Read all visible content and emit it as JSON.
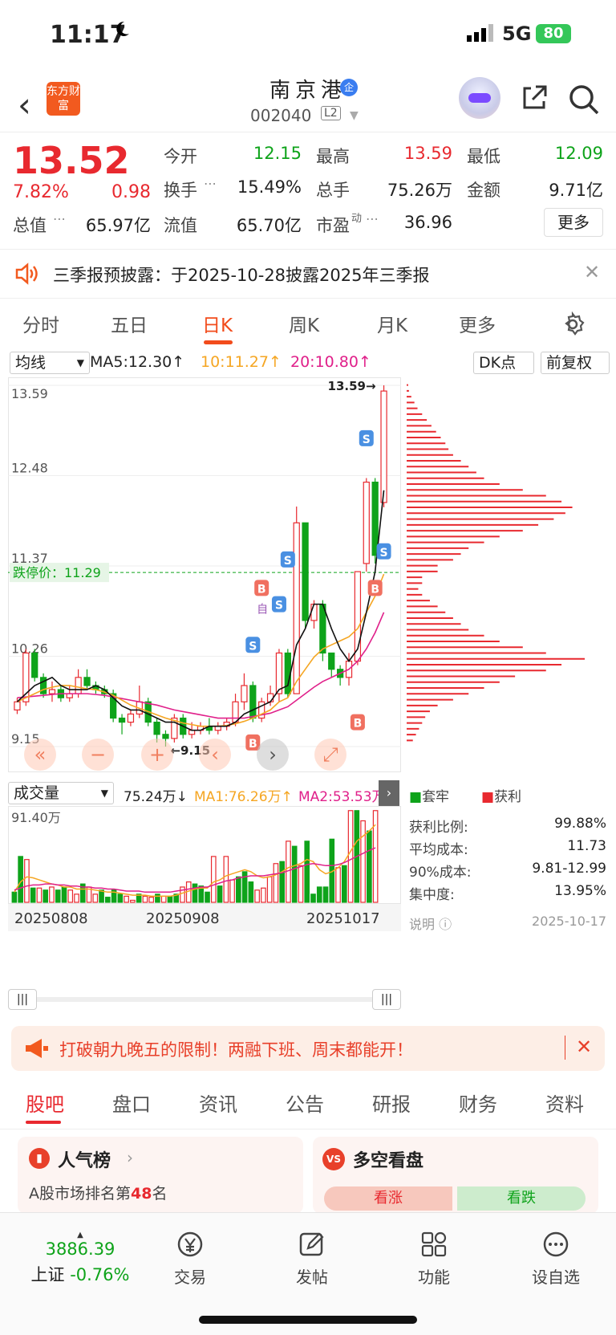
{
  "status": {
    "time": "11:17",
    "network": "5G",
    "battery": "80"
  },
  "header": {
    "logo": "东方财富",
    "name": "南京港",
    "badge": "企",
    "code": "002040",
    "level": "L2"
  },
  "quote": {
    "price": "13.52",
    "pct": "7.82%",
    "change": "0.98",
    "fields": [
      {
        "label": "今开",
        "value": "12.15",
        "color": "green"
      },
      {
        "label": "最高",
        "value": "13.59",
        "color": "red"
      },
      {
        "label": "最低",
        "value": "12.09",
        "color": "green"
      },
      {
        "label": "换手",
        "value": "15.49%",
        "color": "black"
      },
      {
        "label": "总手",
        "value": "75.26万",
        "color": "black"
      },
      {
        "label": "金额",
        "value": "9.71亿",
        "color": "black"
      },
      {
        "label": "总值",
        "value": "65.97亿",
        "color": "black"
      },
      {
        "label": "流值",
        "value": "65.70亿",
        "color": "black"
      },
      {
        "label": "市盈",
        "sup": "动",
        "value": "36.96",
        "color": "black"
      }
    ],
    "more": "更多"
  },
  "notice": {
    "text": "三季报预披露：于2025-10-28披露2025年三季报"
  },
  "ktabs": [
    "分时",
    "五日",
    "日K",
    "周K",
    "月K",
    "更多"
  ],
  "ktab_active": 2,
  "ma": {
    "select": "均线",
    "ma5": "MA5:12.30",
    "ma10": "10:11.27",
    "ma20": "20:10.80",
    "dk": "DK点",
    "fq": "前复权"
  },
  "chart_labels": {
    "y_ticks": [
      "13.59",
      "12.48",
      "11.37",
      "10.26",
      "9.15"
    ],
    "limit_down": "跌停价：11.29",
    "high_mark": "13.59",
    "low_mark": "9.15",
    "auto": "自",
    "b": "B",
    "s": "S"
  },
  "chart_data": [
    {
      "type": "candlestick",
      "title": "日K",
      "ylim": [
        9.15,
        13.59
      ],
      "candles": [
        [
          9.6,
          9.7,
          9.55,
          9.75
        ],
        [
          9.7,
          10.3,
          9.65,
          10.35
        ],
        [
          10.3,
          10.0,
          9.95,
          10.35
        ],
        [
          10.0,
          9.8,
          9.75,
          10.05
        ],
        [
          9.8,
          9.85,
          9.7,
          9.95
        ],
        [
          9.85,
          9.75,
          9.7,
          9.9
        ],
        [
          9.75,
          9.8,
          9.7,
          9.9
        ],
        [
          9.8,
          10.0,
          9.75,
          10.1
        ],
        [
          10.0,
          9.9,
          9.85,
          10.1
        ],
        [
          9.9,
          9.85,
          9.8,
          9.95
        ],
        [
          9.85,
          9.8,
          9.75,
          9.9
        ],
        [
          9.8,
          9.5,
          9.45,
          9.85
        ],
        [
          9.5,
          9.45,
          9.3,
          9.55
        ],
        [
          9.45,
          9.55,
          9.4,
          9.6
        ],
        [
          9.55,
          9.7,
          9.5,
          9.9
        ],
        [
          9.7,
          9.45,
          9.4,
          9.75
        ],
        [
          9.45,
          9.3,
          9.2,
          9.5
        ],
        [
          9.3,
          9.25,
          9.15,
          9.35
        ],
        [
          9.25,
          9.5,
          9.2,
          9.55
        ],
        [
          9.5,
          9.3,
          9.25,
          9.55
        ],
        [
          9.3,
          9.35,
          9.25,
          9.45
        ],
        [
          9.35,
          9.4,
          9.3,
          9.45
        ],
        [
          9.4,
          9.35,
          9.3,
          9.5
        ],
        [
          9.35,
          9.4,
          9.3,
          9.45
        ],
        [
          9.4,
          9.45,
          9.35,
          9.5
        ],
        [
          9.45,
          9.7,
          9.4,
          9.8
        ],
        [
          9.7,
          9.9,
          9.6,
          10.05
        ],
        [
          9.9,
          9.5,
          9.45,
          9.95
        ],
        [
          9.5,
          9.7,
          9.45,
          9.75
        ],
        [
          9.7,
          9.8,
          9.65,
          9.9
        ],
        [
          9.8,
          10.3,
          9.7,
          10.35
        ],
        [
          10.3,
          9.8,
          9.75,
          10.35
        ],
        [
          9.8,
          11.9,
          9.8,
          12.1
        ],
        [
          11.9,
          10.7,
          10.6,
          11.9
        ],
        [
          10.7,
          10.9,
          10.6,
          10.95
        ],
        [
          10.9,
          10.3,
          10.2,
          10.95
        ],
        [
          10.3,
          10.1,
          10.0,
          10.3
        ],
        [
          10.1,
          10.0,
          9.9,
          10.15
        ],
        [
          10.0,
          10.2,
          9.9,
          10.3
        ],
        [
          10.2,
          11.3,
          10.15,
          11.3
        ],
        [
          11.4,
          12.4,
          11.3,
          12.45
        ],
        [
          12.4,
          11.5,
          11.4,
          12.45
        ],
        [
          12.15,
          13.52,
          12.09,
          13.59
        ]
      ],
      "ma5": [
        9.7,
        9.8,
        9.9,
        9.95,
        10.0,
        9.9,
        9.85,
        9.85,
        9.85,
        9.9,
        9.85,
        9.75,
        9.65,
        9.6,
        9.6,
        9.55,
        9.5,
        9.45,
        9.45,
        9.4,
        9.35,
        9.35,
        9.4,
        9.4,
        9.4,
        9.45,
        9.55,
        9.6,
        9.65,
        9.7,
        9.85,
        9.9,
        10.4,
        10.6,
        10.9,
        10.9,
        10.6,
        10.35,
        10.2,
        10.35,
        10.8,
        11.3,
        12.3
      ],
      "ma10": [
        9.7,
        9.75,
        9.8,
        9.85,
        9.88,
        9.9,
        9.9,
        9.88,
        9.86,
        9.85,
        9.82,
        9.78,
        9.72,
        9.66,
        9.62,
        9.58,
        9.54,
        9.5,
        9.47,
        9.44,
        9.42,
        9.4,
        9.4,
        9.4,
        9.41,
        9.43,
        9.46,
        9.5,
        9.55,
        9.6,
        9.7,
        9.75,
        9.95,
        10.1,
        10.25,
        10.35,
        10.4,
        10.45,
        10.5,
        10.6,
        10.8,
        11.0,
        11.27
      ],
      "ma20": [
        9.75,
        9.76,
        9.77,
        9.78,
        9.79,
        9.8,
        9.8,
        9.8,
        9.8,
        9.79,
        9.78,
        9.76,
        9.74,
        9.72,
        9.7,
        9.68,
        9.66,
        9.63,
        9.6,
        9.58,
        9.56,
        9.54,
        9.52,
        9.5,
        9.5,
        9.5,
        9.5,
        9.52,
        9.54,
        9.56,
        9.6,
        9.64,
        9.72,
        9.8,
        9.88,
        9.95,
        10.0,
        10.05,
        10.1,
        10.2,
        10.35,
        10.55,
        10.8
      ]
    },
    {
      "type": "bar",
      "title": "成交量",
      "ylim": [
        0,
        91.4
      ],
      "values": [
        10,
        45,
        42,
        14,
        14,
        12,
        15,
        12,
        15,
        12,
        8,
        18,
        15,
        8,
        12,
        5,
        12,
        8,
        6,
        2,
        8,
        6,
        5,
        8,
        6,
        6,
        8,
        15,
        20,
        18,
        16,
        10,
        45,
        16,
        45,
        22,
        25,
        30,
        20,
        12,
        14,
        25,
        38,
        40,
        60,
        55,
        36,
        60,
        8,
        15,
        15,
        62,
        34,
        36,
        90,
        90,
        80,
        70,
        90
      ],
      "ma1": [
        10,
        20,
        25,
        24,
        22,
        20,
        18,
        17,
        15,
        15,
        13,
        13,
        13,
        12,
        11,
        10,
        10,
        9,
        8,
        7,
        7,
        7,
        6,
        6,
        6,
        6,
        7,
        9,
        11,
        13,
        14,
        14,
        20,
        22,
        26,
        28,
        30,
        32,
        30,
        26,
        24,
        25,
        27,
        30,
        34,
        36,
        38,
        42,
        40,
        32,
        28,
        30,
        34,
        40,
        50,
        60,
        65,
        70,
        76.26
      ],
      "ma2": [
        12,
        14,
        16,
        17,
        17,
        18,
        18,
        17,
        17,
        16,
        16,
        15,
        15,
        14,
        14,
        13,
        13,
        12,
        11,
        11,
        11,
        10,
        10,
        10,
        10,
        10,
        11,
        12,
        13,
        14,
        15,
        15,
        17,
        19,
        21,
        22,
        24,
        25,
        26,
        26,
        26,
        27,
        28,
        29,
        31,
        33,
        35,
        37,
        38,
        37,
        36,
        36,
        37,
        39,
        42,
        45,
        48,
        51,
        53.53
      ]
    }
  ],
  "volume": {
    "select": "成交量",
    "vol": "75.24万",
    "ma1": "MA1:76.26万",
    "ma2": "MA2:53.53万",
    "ymax": "91.40万",
    "dates": [
      "20250808",
      "20250908",
      "20251017"
    ]
  },
  "legend": {
    "trapped": "套牢",
    "profit": "获利"
  },
  "stats": [
    {
      "label": "获利比例:",
      "value": "99.88%"
    },
    {
      "label": "平均成本:",
      "value": "11.73"
    },
    {
      "label": "90%成本:",
      "value": "9.81-12.99"
    },
    {
      "label": "集中度:",
      "value": "13.95%"
    }
  ],
  "stats_note": {
    "label": "说明",
    "date": "2025-10-17"
  },
  "distribution": [
    2,
    3,
    6,
    10,
    14,
    20,
    26,
    32,
    38,
    44,
    50,
    54,
    60,
    70,
    80,
    90,
    100,
    120,
    150,
    180,
    200,
    214,
    205,
    190,
    170,
    150,
    120,
    100,
    80,
    70,
    60,
    40,
    40,
    20,
    20,
    15,
    20,
    30,
    40,
    50,
    60,
    70,
    80,
    100,
    120,
    150,
    180,
    230,
    200,
    180,
    140,
    120,
    100,
    80,
    60,
    40,
    30,
    24,
    20,
    16,
    12,
    8
  ],
  "promo": {
    "text": "打破朝九晚五的限制！两融下班、周末都能开！"
  },
  "btabs": [
    "股吧",
    "盘口",
    "资讯",
    "公告",
    "研报",
    "财务",
    "资料"
  ],
  "cards": {
    "popular_title": "人气榜",
    "popular_sub": "A股市场排名第",
    "popular_rank": "48",
    "popular_suffix": "名",
    "vs_title": "多空看盘",
    "up": "看涨",
    "down": "看跌"
  },
  "bottom": {
    "index_value": "3886.39",
    "index_name": "上证",
    "index_pct": "-0.76%",
    "nav": [
      "交易",
      "发帖",
      "功能",
      "设自选"
    ]
  }
}
